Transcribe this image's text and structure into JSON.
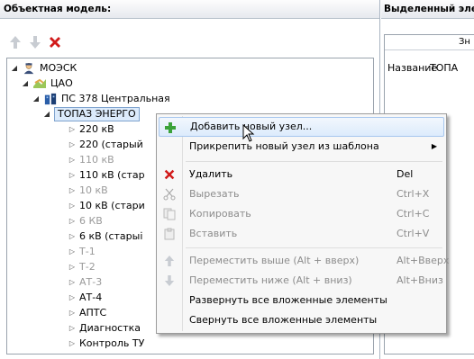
{
  "left_panel": {
    "title": "Объектная модель:"
  },
  "right_panel": {
    "title": "Выделенный эле",
    "column_header": "Зн",
    "row_label": "Название",
    "row_value": "ТОПА"
  },
  "toolbar": {
    "up_icon": "arrow-up-icon",
    "down_icon": "arrow-down-icon",
    "delete_icon": "red-x-icon"
  },
  "tree": {
    "root": "МОЭСК",
    "cao": "ЦАО",
    "ps": "ПС 378 Центральная",
    "topaz": "ТОПАЗ ЭНЕРГО",
    "children": [
      {
        "label": "220 кВ",
        "gray": false
      },
      {
        "label": "220 (старый",
        "gray": false
      },
      {
        "label": "110 кВ",
        "gray": true
      },
      {
        "label": "110 кВ (стар",
        "gray": false
      },
      {
        "label": "10 кВ",
        "gray": true
      },
      {
        "label": "10 кВ (стари",
        "gray": false
      },
      {
        "label": "6 КВ",
        "gray": true
      },
      {
        "label": "6 кВ (старыі",
        "gray": false
      },
      {
        "label": "Т-1",
        "gray": true
      },
      {
        "label": "Т-2",
        "gray": true
      },
      {
        "label": "АТ-3",
        "gray": true
      },
      {
        "label": "АТ-4",
        "gray": false
      },
      {
        "label": "АПТС",
        "gray": false
      },
      {
        "label": "Диагностка",
        "gray": false
      },
      {
        "label": "Контроль ТУ",
        "gray": false
      }
    ]
  },
  "context_menu": {
    "items": [
      {
        "label": "Добавить новый узел...",
        "shortcut": "",
        "icon": "green-plus-icon",
        "disabled": false,
        "hover": true
      },
      {
        "label": "Прикрепить новый узел из шаблона",
        "shortcut": "",
        "icon": "",
        "disabled": false,
        "submenu": true
      },
      {
        "label": "Удалить",
        "shortcut": "Del",
        "icon": "red-x-icon",
        "disabled": false
      },
      {
        "label": "Вырезать",
        "shortcut": "Ctrl+X",
        "icon": "scissors-icon",
        "disabled": true
      },
      {
        "label": "Копировать",
        "shortcut": "Ctrl+C",
        "icon": "copy-icon",
        "disabled": true
      },
      {
        "label": "Вставить",
        "shortcut": "Ctrl+V",
        "icon": "paste-icon",
        "disabled": true
      },
      {
        "label": "Переместить выше (Alt + вверх)",
        "shortcut": "Alt+Вверх",
        "icon": "arrow-up-icon",
        "disabled": true
      },
      {
        "label": "Переместить ниже (Alt + вниз)",
        "shortcut": "Alt+Вниз",
        "icon": "arrow-down-icon",
        "disabled": true
      },
      {
        "label": "Развернуть все вложенные элементы",
        "shortcut": "",
        "icon": "",
        "disabled": false
      },
      {
        "label": "Свернуть все вложенные элементы",
        "shortcut": "",
        "icon": "",
        "disabled": false
      }
    ]
  },
  "colors": {
    "accent": "#dcebfc",
    "delete_red": "#d11a1a",
    "plus_green": "#3aa23a"
  }
}
